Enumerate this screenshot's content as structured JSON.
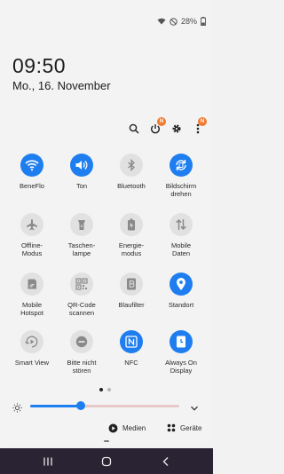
{
  "status": {
    "battery": "28%"
  },
  "clock": {
    "time": "09:50",
    "date": "Mo., 16. November"
  },
  "toolbar": {
    "badge_power": "N",
    "badge_more": "N"
  },
  "tiles": [
    {
      "label": "BeneFlo",
      "on": true,
      "icon": "wifi-icon"
    },
    {
      "label": "Ton",
      "on": true,
      "icon": "sound-icon"
    },
    {
      "label": "Bluetooth",
      "on": false,
      "icon": "bluetooth-icon"
    },
    {
      "label": "Bildschirm\ndrehen",
      "on": true,
      "icon": "rotate-icon"
    },
    {
      "label": "Offline-\nModus",
      "on": false,
      "icon": "airplane-icon"
    },
    {
      "label": "Taschen-\nlampe",
      "on": false,
      "icon": "flashlight-icon"
    },
    {
      "label": "Energie-\nmodus",
      "on": false,
      "icon": "battery-saver-icon"
    },
    {
      "label": "Mobile\nDaten",
      "on": false,
      "icon": "mobile-data-icon"
    },
    {
      "label": "Mobile\nHotspot",
      "on": false,
      "icon": "hotspot-icon"
    },
    {
      "label": "QR-Code\nscannen",
      "on": false,
      "icon": "qr-code-icon"
    },
    {
      "label": "Blaufilter",
      "on": false,
      "icon": "blue-light-filter-icon"
    },
    {
      "label": "Standort",
      "on": true,
      "icon": "location-icon"
    },
    {
      "label": "Smart View",
      "on": false,
      "icon": "smart-view-icon"
    },
    {
      "label": "Bitte nicht\nstören",
      "on": false,
      "icon": "do-not-disturb-icon"
    },
    {
      "label": "NFC",
      "on": true,
      "icon": "nfc-icon"
    },
    {
      "label": "Always On\nDisplay",
      "on": true,
      "icon": "always-on-display-icon"
    }
  ],
  "pager": {
    "pages": 2,
    "current": 1
  },
  "brightness": {
    "level": 0.34
  },
  "bottom": {
    "media_label": "Medien",
    "devices_label": "Geräte"
  },
  "colors": {
    "accent": "#1e7ef0",
    "tile_off": "#e1e1e1",
    "badge": "#f07a30",
    "nav_bg": "#2a2333"
  }
}
